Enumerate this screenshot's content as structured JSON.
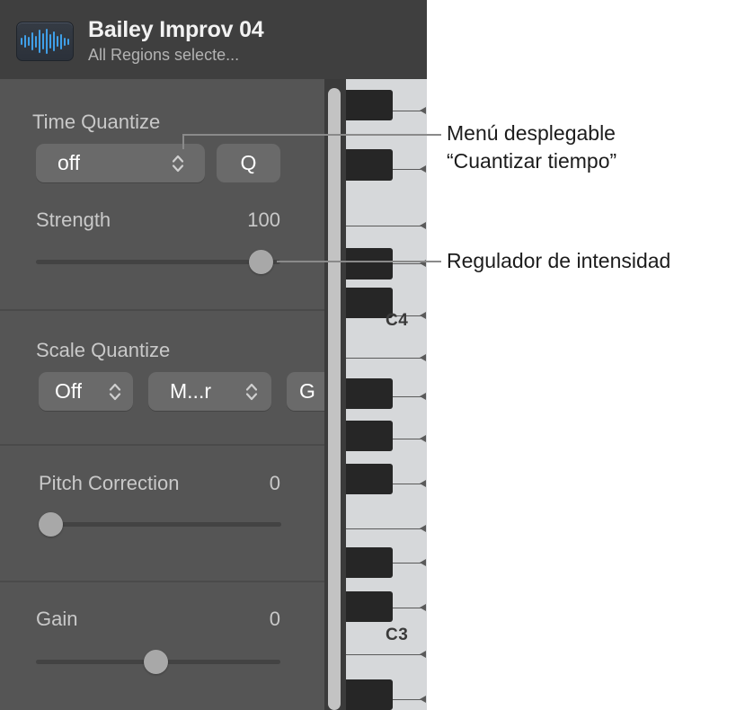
{
  "header": {
    "icon_name": "audio-waveform-icon",
    "title": "Bailey Improv 04",
    "subtitle": "All Regions selecte...",
    "button_icon_name": "window-download-icon"
  },
  "sections": {
    "time_quantize": {
      "label": "Time Quantize",
      "dropdown_value": "off",
      "q_button_label": "Q"
    },
    "strength": {
      "label": "Strength",
      "value": "100"
    },
    "scale_quantize": {
      "label": "Scale Quantize",
      "dropdown1_value": "Off",
      "dropdown2_value": "M...r",
      "dropdown3_value": "G"
    },
    "pitch_correction": {
      "label": "Pitch Correction",
      "value": "0"
    },
    "gain": {
      "label": "Gain",
      "value": "0"
    }
  },
  "piano_roll": {
    "key_labels": [
      "C4",
      "C3"
    ],
    "scrollbar_name": "vertical-scrollbar"
  },
  "callouts": [
    {
      "line1": "Menú desplegable",
      "line2": "“Cuantizar tiempo”"
    },
    {
      "line1": "Regulador de intensidad",
      "line2": ""
    }
  ],
  "colors": {
    "panel_bg": "#555555",
    "header_bg": "#3f3f3f",
    "control_bg": "#6a6a6a",
    "accent_blue": "#3f9fe8",
    "white_key": "#d6d8da",
    "black_key": "#262626",
    "callout_line": "#8a8a8a"
  }
}
